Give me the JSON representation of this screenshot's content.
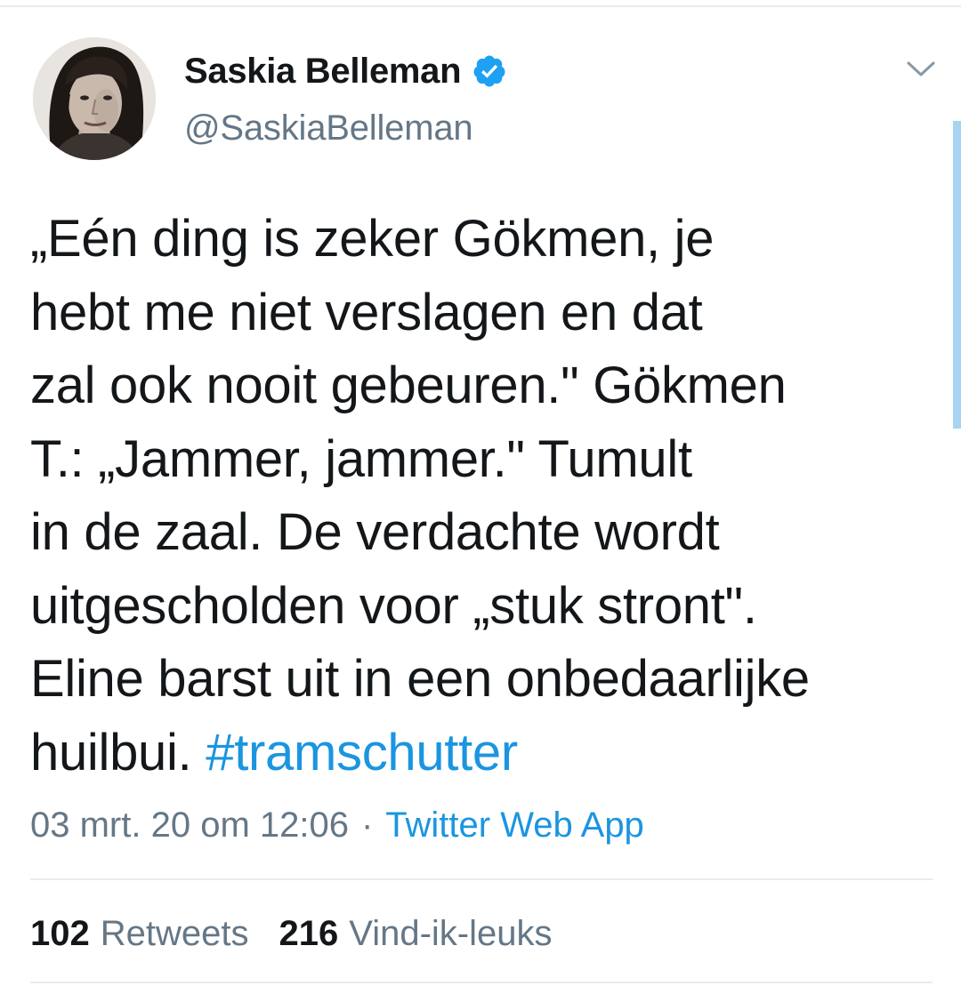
{
  "author": {
    "display_name": "Saskia Belleman",
    "handle": "@SaskiaBelleman",
    "verified": true
  },
  "tweet": {
    "lines": [
      "„Eén ding is zeker Gökmen, je",
      "hebt me niet verslagen en dat",
      "zal ook nooit gebeuren.\" Gökmen",
      "T.: „Jammer, jammer.\" Tumult",
      "in de zaal. De verdachte wordt",
      "uitgescholden voor „stuk stront\".",
      "Eline barst uit in een onbedaarlijke"
    ],
    "last_line_text": "huilbui.",
    "hashtag": "#tramschutter"
  },
  "meta": {
    "timestamp": "03 mrt. 20 om 12:06",
    "separator": "·",
    "source": "Twitter Web App"
  },
  "stats": {
    "retweets_count": "102",
    "retweets_label": "Retweets",
    "likes_count": "216",
    "likes_label": "Vind-ik-leuks"
  },
  "icons": {
    "verified": "verified-badge-icon",
    "more": "chevron-down-icon"
  },
  "colors": {
    "accent": "#1b95e0",
    "verified": "#1da1f2",
    "text": "#14171a",
    "secondary_text": "#657786",
    "divider": "#e6ecf0"
  }
}
